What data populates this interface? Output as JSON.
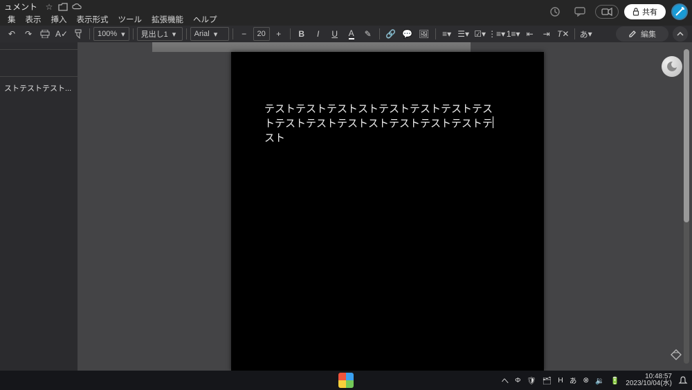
{
  "titlebar": {
    "doc_title": "ュメント"
  },
  "titlebar_right": {
    "share_label": "共有"
  },
  "menu": [
    "集",
    "表示",
    "挿入",
    "表示形式",
    "ツール",
    "拡張機能",
    "ヘルプ"
  ],
  "toolbar": {
    "zoom": "100%",
    "style": "見出し1",
    "font": "Arial",
    "font_size": "20",
    "ime_lang": "あ",
    "edit_label": "編集"
  },
  "sidebar": {
    "outline_item": "ストテストテスト..."
  },
  "document": {
    "text_line1": "テストテストテストストテストテストテストテス",
    "text_line2": "トテストテストテストストテストテストテストテ",
    "text_line3": "スト"
  },
  "taskbar": {
    "tray_icons": [
      "へ",
      "Φ",
      "🛡",
      "🗂",
      "H",
      "あ",
      "⊗",
      "🔉",
      "🔋"
    ],
    "clock_time": "10:48:57",
    "clock_date": "2023/10/04(水)"
  }
}
